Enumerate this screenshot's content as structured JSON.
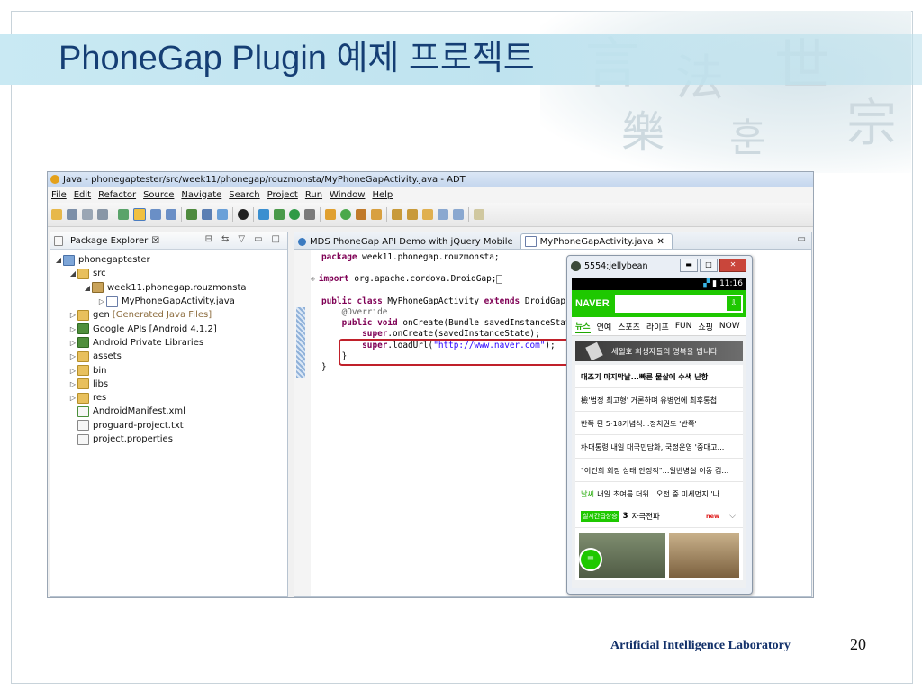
{
  "slide": {
    "title": "PhoneGap Plugin 예제 프로젝트",
    "footer": "Artificial Intelligence Laboratory",
    "page_number": "20"
  },
  "ide": {
    "window_title": "Java - phonegaptester/src/week11/phonegap/rouzmonsta/MyPhoneGapActivity.java - ADT",
    "menu": [
      "File",
      "Edit",
      "Refactor",
      "Source",
      "Navigate",
      "Search",
      "Project",
      "Run",
      "Window",
      "Help"
    ],
    "package_explorer": {
      "title": "Package Explorer",
      "close_glyph": "☒",
      "tree": [
        {
          "label": "phonegaptester",
          "icon": "project-icon",
          "twisty": "◢"
        },
        {
          "label": "src",
          "icon": "folder-icon",
          "twisty": "◢"
        },
        {
          "label": "week11.phonegap.rouzmonsta",
          "icon": "package-icon",
          "twisty": "◢"
        },
        {
          "label": "MyPhoneGapActivity.java",
          "icon": "java-file-icon",
          "twisty": "▷"
        },
        {
          "label": "gen",
          "note": "[Generated Java Files]",
          "icon": "folder-icon",
          "twisty": "▷"
        },
        {
          "label": "Google APIs [Android 4.1.2]",
          "icon": "library-icon",
          "twisty": "▷"
        },
        {
          "label": "Android Private Libraries",
          "icon": "library-icon",
          "twisty": "▷"
        },
        {
          "label": "assets",
          "icon": "folder-icon",
          "twisty": "▷"
        },
        {
          "label": "bin",
          "icon": "folder-icon",
          "twisty": "▷"
        },
        {
          "label": "libs",
          "icon": "folder-icon",
          "twisty": "▷"
        },
        {
          "label": "res",
          "icon": "folder-icon",
          "twisty": "▷"
        },
        {
          "label": "AndroidManifest.xml",
          "icon": "xml-file-icon",
          "twisty": ""
        },
        {
          "label": "proguard-project.txt",
          "icon": "text-file-icon",
          "twisty": ""
        },
        {
          "label": "project.properties",
          "icon": "text-file-icon",
          "twisty": ""
        }
      ]
    },
    "editor": {
      "tabs": [
        "MDS PhoneGap API Demo with jQuery Mobile",
        "MyPhoneGapActivity.java"
      ],
      "code": {
        "line1_kw": "package",
        "line1_rest": " week11.phonegap.rouzmonsta;",
        "line2_kw": "import",
        "line2_rest": " org.apache.cordova.DroidGap;",
        "line3": [
          "public",
          " ",
          "class",
          " MyPhoneGapActivity ",
          "extends",
          " DroidGap {"
        ],
        "line4": "@Override",
        "line5": [
          "public",
          " ",
          "void",
          " onCreate(Bundle savedInstanceState) {"
        ],
        "line6": [
          "super",
          ".onCreate(savedInstanceState);"
        ],
        "line7": [
          "super",
          ".loadUrl(",
          "\"http://www.naver.com\"",
          ");"
        ],
        "line8": "}",
        "line9": "}"
      }
    },
    "emulator": {
      "title": "5554:jellybean",
      "time": "11:16",
      "naver_logo": "NAVER",
      "nav_tabs": [
        "뉴스",
        "연예",
        "스포츠",
        "라이프",
        "FUN",
        "쇼핑",
        "NOW"
      ],
      "banner": "세월호 희생자들의 명복을 빕니다",
      "news": [
        {
          "cat": "",
          "text": "대조기 마지막날...빠른 물살에 수색 난항"
        },
        {
          "cat": "",
          "text": "檢'법정 최고형' 거론하며 유병언에 최후통첩"
        },
        {
          "cat": "",
          "text": "반쪽 된 5·18기념식...정치권도 '반쪽'"
        },
        {
          "cat": "",
          "text": "朴대통령 내일 대국민담화, 국정운영 '중대고..."
        },
        {
          "cat": "",
          "text": "\"이건희 회장 상태 안정적\"...일반병실 이동 검..."
        },
        {
          "cat": "날씨",
          "text": "내일 초여름 더위...오전 중 미세먼지 '나..."
        }
      ],
      "realtime": {
        "badge": "실시간급상승",
        "rank": "3",
        "keyword": "자극전파",
        "new_label": "new"
      }
    }
  }
}
